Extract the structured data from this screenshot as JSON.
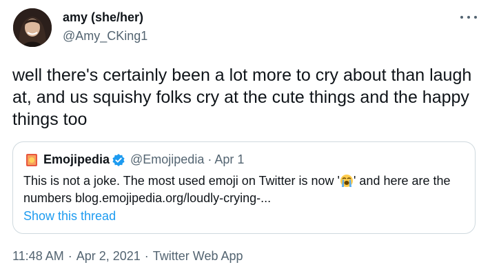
{
  "author": {
    "display_name": "amy (she/her)",
    "handle": "@Amy_CKing1",
    "avatar_icon": "avatar-photo"
  },
  "tweet": {
    "text": "well there's certainly been a lot more to cry about than laugh at, and us squishy folks cry at the cute things and the happy things too"
  },
  "quote": {
    "logo_icon": "emojipedia-logo",
    "name": "Emojipedia",
    "verified_icon": "verified-badge",
    "handle": "@Emojipedia",
    "dot": "·",
    "date": "Apr 1",
    "text_before": "This is not a joke. The most used emoji on Twitter is now '",
    "emoji_icon": "loudly-crying-face",
    "text_after": "' and here are the numbers blog.emojipedia.org/loudly-crying-...",
    "show_thread": "Show this thread"
  },
  "footer": {
    "time": "11:48 AM",
    "sep1": "·",
    "date": "Apr 2, 2021",
    "sep2": "·",
    "app": "Twitter Web App"
  },
  "colors": {
    "link": "#1d9bf0",
    "muted": "#536471",
    "text": "#0f1419",
    "border": "#cfd9de",
    "verified": "#1d9bf0"
  }
}
